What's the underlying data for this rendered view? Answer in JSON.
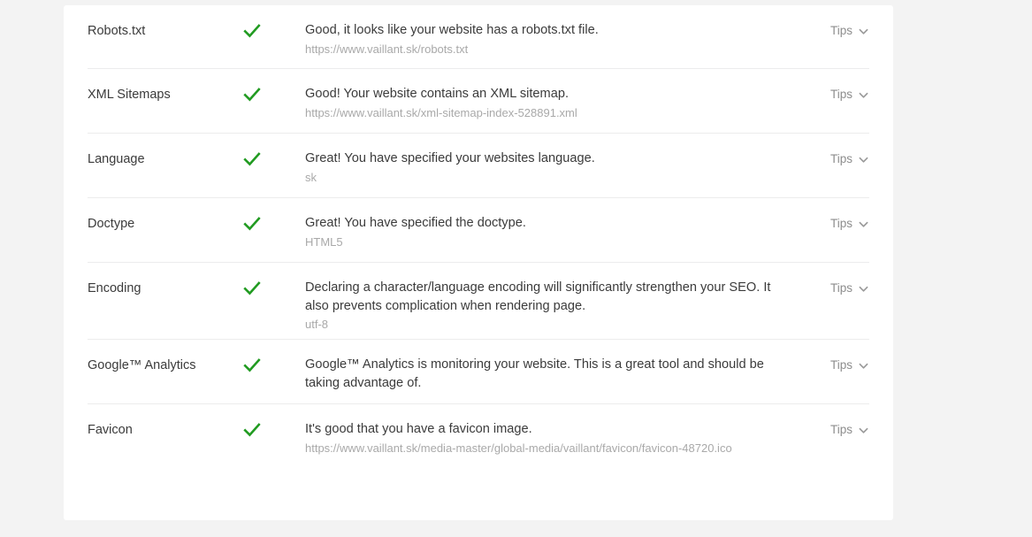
{
  "page": {
    "background_color": "#f3f3f3",
    "card_background": "#ffffff"
  },
  "colors": {
    "check_green": "#219b21",
    "label_text": "#3b3b3b",
    "sub_text": "#a9a9a9",
    "tips_text": "#8d8d8d",
    "divider": "#ececed"
  },
  "report": {
    "rows": [
      {
        "label": "Robots.txt",
        "status_icon": "check-icon",
        "status": "pass",
        "message": "Good, it looks like your website has a robots.txt file.",
        "detail": "https://www.vaillant.sk/robots.txt",
        "tips_label": "Tips",
        "tips_icon": "chevron-down-icon"
      },
      {
        "label": "XML Sitemaps",
        "status_icon": "check-icon",
        "status": "pass",
        "message": "Good! Your website contains an XML sitemap.",
        "detail": "https://www.vaillant.sk/xml-sitemap-index-528891.xml",
        "tips_label": "Tips",
        "tips_icon": "chevron-down-icon"
      },
      {
        "label": "Language",
        "status_icon": "check-icon",
        "status": "pass",
        "message": "Great! You have specified your websites language.",
        "detail": "sk",
        "tips_label": "Tips",
        "tips_icon": "chevron-down-icon"
      },
      {
        "label": "Doctype",
        "status_icon": "check-icon",
        "status": "pass",
        "message": "Great! You have specified the doctype.",
        "detail": "HTML5",
        "tips_label": "Tips",
        "tips_icon": "chevron-down-icon"
      },
      {
        "label": "Encoding",
        "status_icon": "check-icon",
        "status": "pass",
        "message": "Declaring a character/language encoding will significantly strengthen your SEO. It also prevents complication when rendering page.",
        "detail": "utf-8",
        "tips_label": "Tips",
        "tips_icon": "chevron-down-icon"
      },
      {
        "label": "Google™ Analytics",
        "status_icon": "check-icon",
        "status": "pass",
        "message": "Google™ Analytics is monitoring your website. This is a great tool and should be taking advantage of.",
        "detail": "",
        "tips_label": "Tips",
        "tips_icon": "chevron-down-icon"
      },
      {
        "label": "Favicon",
        "status_icon": "check-icon",
        "status": "pass",
        "message": "It's good that you have a favicon image.",
        "detail": "https://www.vaillant.sk/media-master/global-media/vaillant/favicon/favicon-48720.ico",
        "tips_label": "Tips",
        "tips_icon": "chevron-down-icon"
      }
    ]
  }
}
